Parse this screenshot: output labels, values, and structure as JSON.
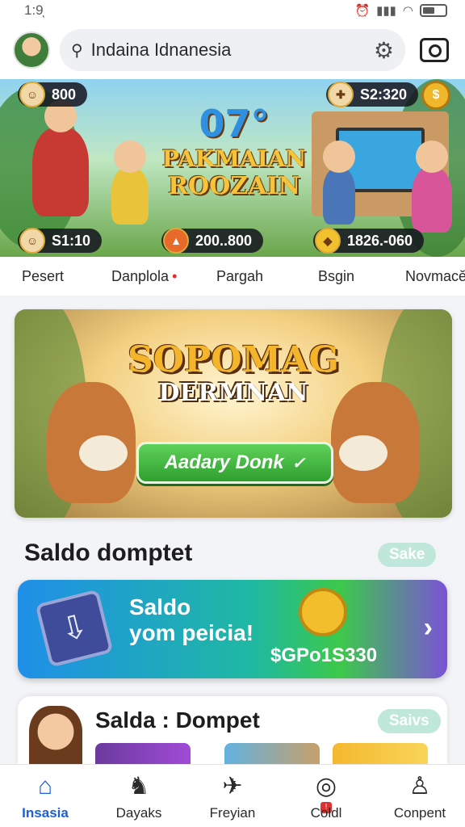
{
  "status_bar": {
    "time": "1:9ͅ"
  },
  "header": {
    "search_value": "Indaina Idnanesia"
  },
  "hero": {
    "number": "07°",
    "title_line1": "PAKMAIAN",
    "title_line2": "ROOZAIN",
    "stat_top_left": "800",
    "stat_top_right": "S2:320",
    "stat_bottom_left": "S1:10",
    "stat_bottom_mid": "200..800",
    "stat_bottom_right": "1826.-060"
  },
  "tabs": [
    {
      "label": "Pesert"
    },
    {
      "label": "Danplola"
    },
    {
      "label": "Pargah"
    },
    {
      "label": "Bsgin"
    },
    {
      "label": "Novmacĕ"
    }
  ],
  "promo": {
    "title_line1": "SOPOMAG",
    "title_line2": "DERMNAN",
    "button_label": "Aadary Donk",
    "button_icon": "check-icon"
  },
  "wallet_section": {
    "title": "Saldo domptet",
    "badge": "Sake",
    "card_line1": "Saldo",
    "card_line2": "yom peicia!",
    "card_amount": "$GPo1S330"
  },
  "dompet_card": {
    "title": "Salda : Dompet",
    "badge": "Saivs"
  },
  "bottom_nav": [
    {
      "label": "Insasia",
      "icon": "home-icon",
      "active": true
    },
    {
      "label": "Dayaks",
      "icon": "game-icon"
    },
    {
      "label": "Freyian",
      "icon": "rocket-icon"
    },
    {
      "label": "Coldl",
      "icon": "coin-icon"
    },
    {
      "label": "Conpent",
      "icon": "profile-icon"
    }
  ],
  "colors": {
    "accent": "#1c5fd6",
    "promo_button": "#3cb83a",
    "badge": "#bfe8da"
  }
}
